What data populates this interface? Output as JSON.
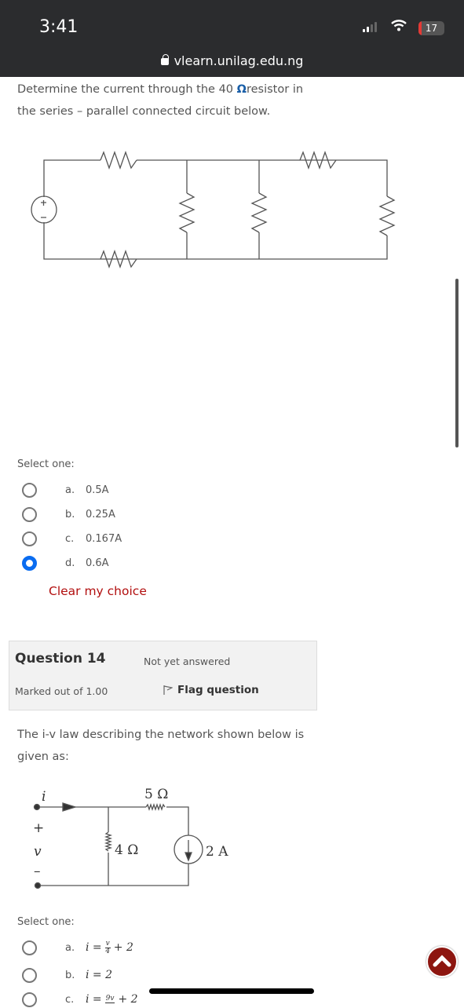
{
  "status_bar": {
    "time": "3:41",
    "battery": "17",
    "url": "vlearn.unilag.edu.ng"
  },
  "q13": {
    "text_line1": "Determine the current through the 40 ",
    "omega": "Ω",
    "text_line1b": "resistor in",
    "text_line2": "the series – parallel connected circuit below.",
    "select_label": "Select one:",
    "options": [
      {
        "letter": "a.",
        "value": "0.5A",
        "selected": false
      },
      {
        "letter": "b.",
        "value": "0.25A",
        "selected": false
      },
      {
        "letter": "c.",
        "value": "0.167A",
        "selected": false
      },
      {
        "letter": "d.",
        "value": "0.6A",
        "selected": true
      }
    ],
    "clear_choice": "Clear my choice"
  },
  "q14": {
    "title": "Question 14",
    "state": "Not yet answered",
    "marked": "Marked out of 1.00",
    "flag": "Flag question",
    "text_line1": "The i-v law describing the network shown below is",
    "text_line2": "given as:",
    "circuit": {
      "current_label": "i",
      "r1": "5 Ω",
      "r2": "4 Ω",
      "source": "2 A",
      "plus": "+",
      "v": "v",
      "minus": "–"
    },
    "select_label": "Select one:",
    "options": [
      {
        "letter": "a.",
        "lhs": "i =",
        "num": "v",
        "den": "4",
        "rhs": "+ 2"
      },
      {
        "letter": "b.",
        "lhs": "i = 2"
      },
      {
        "letter": "c.",
        "lhs": "i =",
        "num": "9v",
        "den": "",
        "rhs": "+ 2"
      }
    ]
  },
  "colors": {
    "accent": "#0a6cf0",
    "link": "#b20f0f",
    "scroll_top": "#8d1610"
  }
}
